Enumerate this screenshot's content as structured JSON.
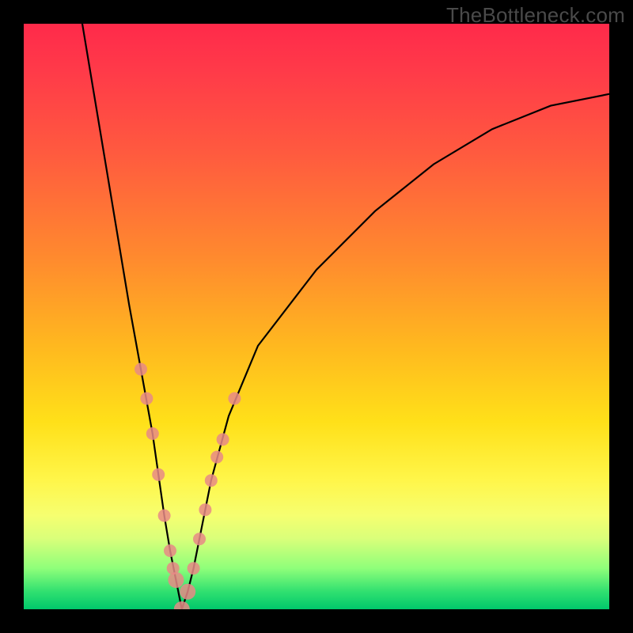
{
  "watermark": "TheBottleneck.com",
  "chart_data": {
    "type": "line",
    "title": "",
    "xlabel": "",
    "ylabel": "",
    "xlim": [
      0,
      100
    ],
    "ylim": [
      0,
      100
    ],
    "grid": false,
    "legend": false,
    "curve": {
      "description": "V-shaped bottleneck curve, minimum near x≈27, steep on left, asymptotic on right",
      "x": [
        10,
        12,
        14,
        16,
        18,
        20,
        22,
        24,
        25,
        26,
        27,
        28,
        29,
        30,
        32,
        35,
        40,
        50,
        60,
        70,
        80,
        90,
        100
      ],
      "y": [
        100,
        88,
        76,
        64,
        52,
        41,
        30,
        16,
        10,
        5,
        0,
        3,
        7,
        12,
        22,
        33,
        45,
        58,
        68,
        76,
        82,
        86,
        88
      ]
    },
    "points": {
      "description": "highlighted sample points along the lower portion of the curve",
      "x": [
        20,
        21,
        22,
        23,
        24,
        25,
        25.5,
        26,
        27,
        28,
        29,
        30,
        31,
        32,
        33,
        34,
        36
      ],
      "y": [
        41,
        36,
        30,
        23,
        16,
        10,
        7,
        5,
        0,
        3,
        7,
        12,
        17,
        22,
        26,
        29,
        36
      ]
    },
    "background_gradient": {
      "top": "#ff2a4a",
      "mid_upper": "#ff8a2e",
      "mid": "#ffe019",
      "mid_lower": "#f6ff70",
      "bottom": "#00c86b"
    }
  }
}
